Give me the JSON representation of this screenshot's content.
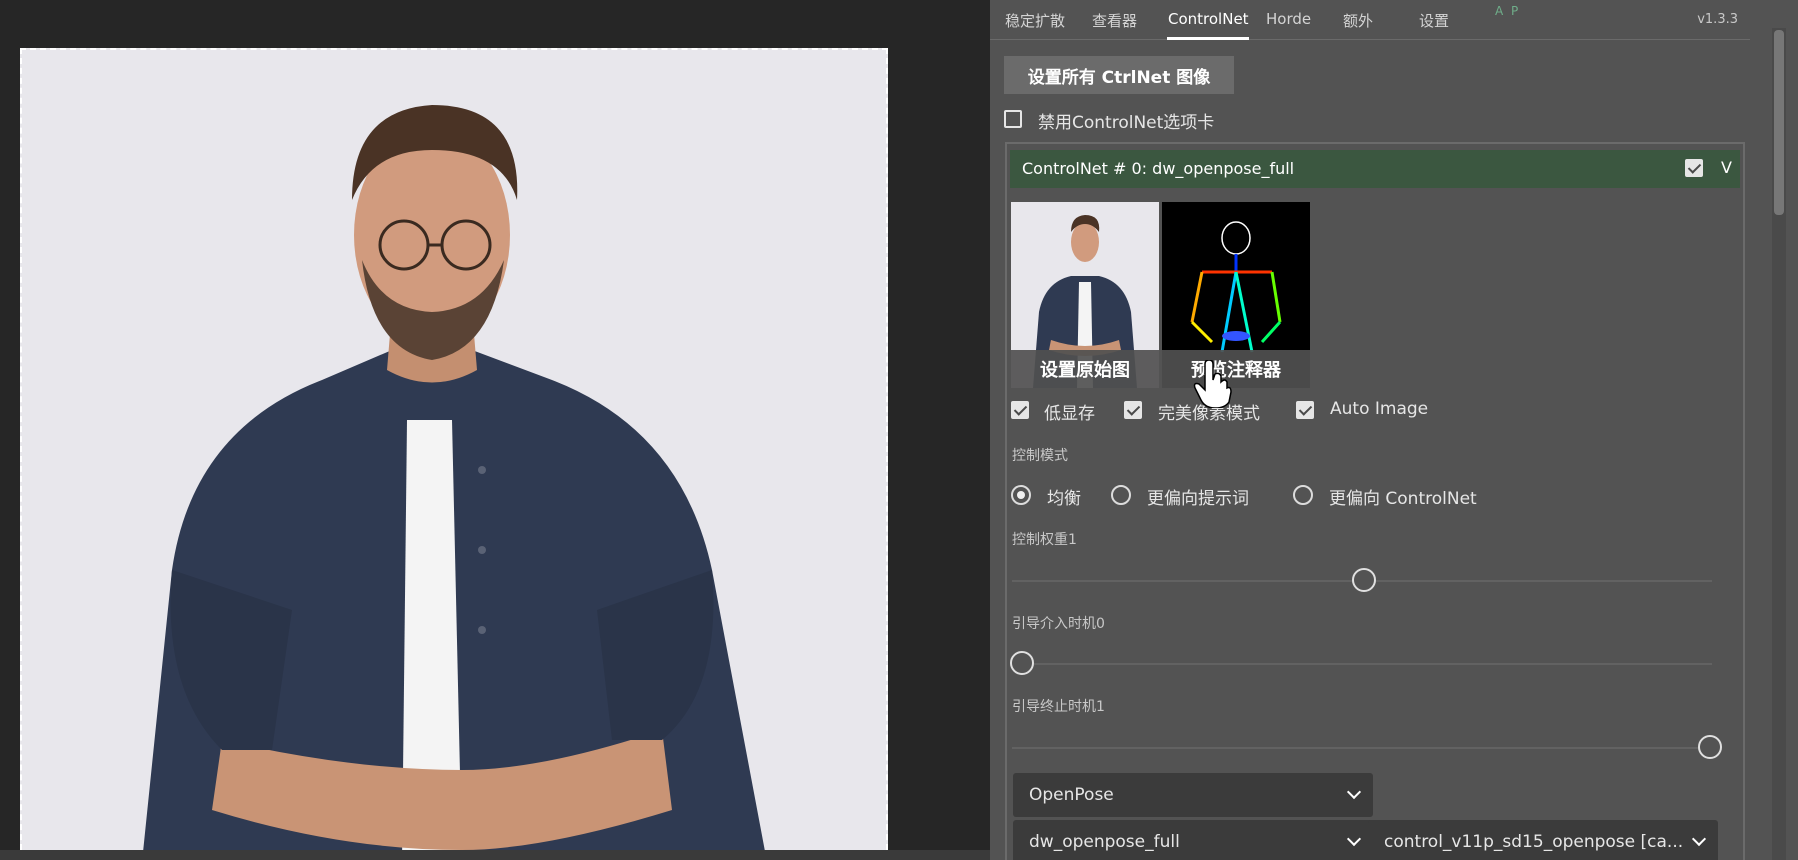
{
  "tabs": [
    "稳定扩散",
    "查看器",
    "ControlNet",
    "Horde",
    "额外",
    "设置"
  ],
  "ap_label": "A P",
  "version": "v1.3.3",
  "set_all_button": "设置所有 CtrlNet 图像",
  "disable_tab_label": "禁用ControlNet选项卡",
  "unit": {
    "title": "ControlNet # 0: dw_openpose_full",
    "enabled": true,
    "collapse_icon": "V"
  },
  "thumbnails": {
    "original_caption": "设置原始图",
    "preprocessor_caption": "预览注释器"
  },
  "options": {
    "low_vram": "低显存",
    "pixel_perfect": "完美像素模式",
    "auto_image": "Auto Image"
  },
  "control_mode": {
    "label": "控制模式",
    "options": [
      "均衡",
      "更偏向提示词",
      "更偏向 ControlNet"
    ],
    "selected_index": 0
  },
  "sliders": {
    "weight_label": "控制权重1",
    "weight_value": 1,
    "start_label": "引导介入时机0",
    "start_value": 0,
    "end_label": "引导终止时机1",
    "end_value": 1
  },
  "selects": {
    "control_type": "OpenPose",
    "preprocessor": "dw_openpose_full",
    "model": "control_v11p_sd15_openpose [ca..."
  },
  "colors": {
    "panel_bg": "#535353",
    "unit_header": "#3b5740",
    "canvas_bg": "#262626"
  }
}
